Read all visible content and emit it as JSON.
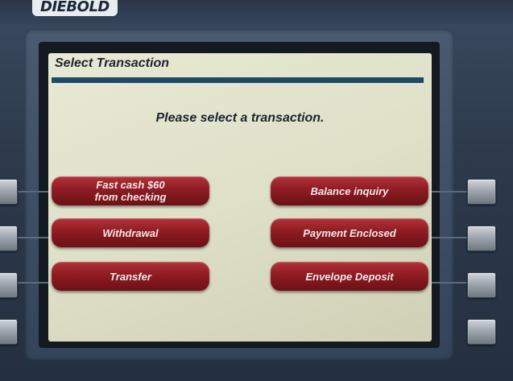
{
  "brand": {
    "logo_text": "DIEBOLD"
  },
  "screen": {
    "title": "Select Transaction",
    "prompt": "Please select a transaction."
  },
  "buttons": {
    "left": [
      {
        "label": "Fast cash $60\nfrom checking"
      },
      {
        "label": "Withdrawal"
      },
      {
        "label": "Transfer"
      }
    ],
    "right": [
      {
        "label": "Balance inquiry"
      },
      {
        "label": "Payment Enclosed"
      },
      {
        "label": "Envelope Deposit"
      }
    ]
  },
  "colors": {
    "screen_background": "#e2e3cc",
    "title_rule": "#1f4a63",
    "button_red": "#9b1f27",
    "button_text": "#f3e9e9",
    "bezel": "#34445a"
  }
}
